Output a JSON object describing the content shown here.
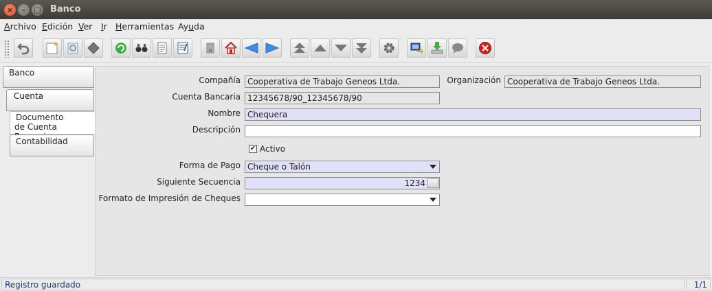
{
  "window": {
    "title": "Banco"
  },
  "menu": {
    "archivo": {
      "u": "A",
      "rest": "rchivo"
    },
    "edicion": {
      "u": "E",
      "rest": "dición"
    },
    "ver": {
      "u": "V",
      "rest": "er"
    },
    "ir": {
      "u": "I",
      "rest": "r"
    },
    "herramientas": {
      "u": "H",
      "rest": "erramientas"
    },
    "ayuda": {
      "pre": "Ay",
      "u": "u",
      "rest": "da"
    }
  },
  "tabs": [
    {
      "label": "Banco"
    },
    {
      "label": "Cuenta"
    },
    {
      "label1": "Documento",
      "label2": "de Cuenta Bancaria"
    },
    {
      "label": "Contabilidad"
    }
  ],
  "form": {
    "compania_label": "Compañía",
    "compania_value": "Cooperativa de Trabajo Geneos Ltda.",
    "organizacion_label": "Organización",
    "organizacion_value": "Cooperativa de Trabajo Geneos Ltda.",
    "cuenta_label": "Cuenta Bancaria",
    "cuenta_value": "12345678/90_12345678/90",
    "nombre_label": "Nombre",
    "nombre_value": "Chequera",
    "descripcion_label": "Descripción",
    "descripcion_value": "",
    "activo_label": "Activo",
    "activo_checked": true,
    "forma_pago_label": "Forma de Pago",
    "forma_pago_value": "Cheque o Talón",
    "secuencia_label": "Siguiente Secuencia",
    "secuencia_value": "1234",
    "formato_label": "Formato de Impresión de Cheques",
    "formato_value": ""
  },
  "status": {
    "message": "Registro guardado",
    "count": "1/1"
  },
  "icons": [
    "undo-icon",
    "new-record-icon",
    "copy-record-icon",
    "delete-record-icon",
    "refresh-icon",
    "find-icon",
    "history-icon",
    "report-icon",
    "attachment-icon",
    "home-icon",
    "previous-tab-icon",
    "next-tab-icon",
    "first-record-icon",
    "previous-record-icon",
    "next-record-icon",
    "last-record-icon",
    "process-icon",
    "zoom-across-icon",
    "import-icon",
    "chat-icon",
    "exit-icon"
  ]
}
